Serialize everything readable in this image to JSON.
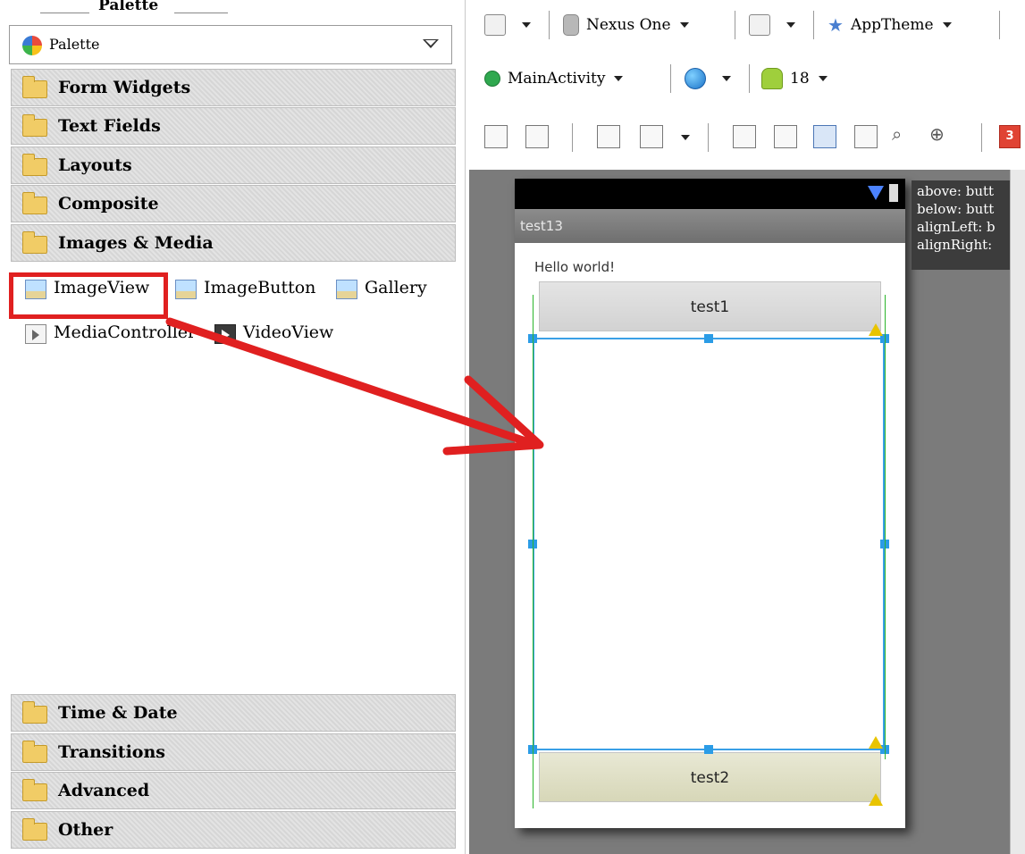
{
  "palette": {
    "header_title": "Palette",
    "selector_label": "Palette",
    "categories_top": [
      {
        "label": "Form Widgets"
      },
      {
        "label": "Text Fields"
      },
      {
        "label": "Layouts"
      },
      {
        "label": "Composite"
      },
      {
        "label": "Images & Media"
      }
    ],
    "images_media_items": [
      {
        "label": "ImageView"
      },
      {
        "label": "ImageButton"
      },
      {
        "label": "Gallery"
      },
      {
        "label": "MediaController"
      },
      {
        "label": "VideoView"
      }
    ],
    "categories_bottom": [
      {
        "label": "Time & Date"
      },
      {
        "label": "Transitions"
      },
      {
        "label": "Advanced"
      },
      {
        "label": "Other"
      }
    ]
  },
  "toolbar": {
    "device": "Nexus One",
    "theme": "AppTheme",
    "activity": "MainActivity",
    "api_level": "18",
    "issues_count": "3"
  },
  "device_preview": {
    "app_title": "test13",
    "hello_text": "Hello world!",
    "button_top": "test1",
    "button_bottom": "test2"
  },
  "tooltip": {
    "lines": [
      "above: butt",
      "below: butt",
      "alignLeft: b",
      "alignRight:"
    ]
  },
  "colors": {
    "highlight": "#e02020",
    "selection": "#3aa0e6",
    "guide": "#2cb52c"
  }
}
